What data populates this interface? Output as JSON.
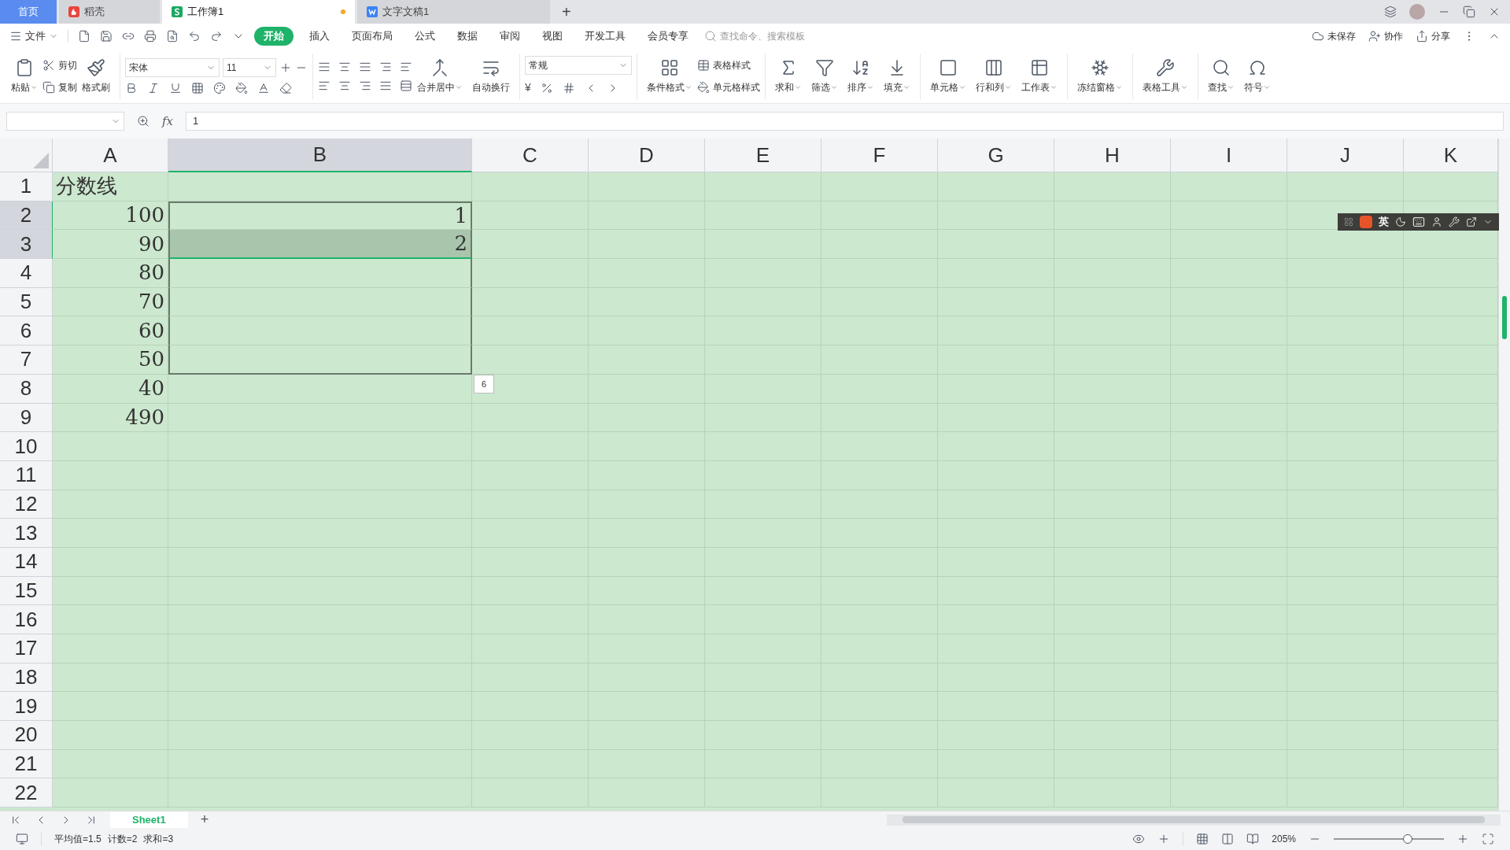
{
  "tabs": [
    {
      "label": "首页",
      "kind": "home",
      "selected": false,
      "unsaved": false
    },
    {
      "label": "稻壳",
      "kind": "docer",
      "selected": false,
      "unsaved": false
    },
    {
      "label": "工作簿1",
      "kind": "sheet",
      "selected": true,
      "unsaved": true
    },
    {
      "label": "文字文稿1",
      "kind": "doc",
      "selected": false,
      "unsaved": false
    }
  ],
  "new_tab": "+",
  "menu": {
    "file": "文件",
    "tabs": [
      {
        "label": "开始",
        "selected": true
      },
      {
        "label": "插入",
        "selected": false
      },
      {
        "label": "页面布局",
        "selected": false
      },
      {
        "label": "公式",
        "selected": false
      },
      {
        "label": "数据",
        "selected": false
      },
      {
        "label": "审阅",
        "selected": false
      },
      {
        "label": "视图",
        "selected": false
      },
      {
        "label": "开发工具",
        "selected": false
      },
      {
        "label": "会员专享",
        "selected": false
      }
    ],
    "search": {
      "placeholder": "查找命令、搜索模板"
    },
    "actions": [
      "未保存",
      "协作",
      "分享"
    ]
  },
  "ribbon": {
    "paste": "粘贴",
    "cut": "剪切",
    "copy": "复制",
    "format_painter": "格式刷",
    "font": "宋体",
    "size": "11",
    "merge": "合并居中",
    "wrap": "自动换行",
    "number_format": "常规",
    "currency": "¥",
    "conditional": "条件格式",
    "table_style": "表格样式",
    "cell_style": "单元格样式",
    "tools": [
      "求和",
      "筛选",
      "排序",
      "填充"
    ],
    "cells": [
      "单元格",
      "行和列",
      "工作表"
    ],
    "freeze": "冻结窗格",
    "table_tools": "表格工具",
    "find": [
      "查找",
      "符号"
    ]
  },
  "formula_bar": {
    "fx": "fx",
    "value": "1"
  },
  "columns": [
    {
      "label": "A",
      "selected": false
    },
    {
      "label": "B",
      "selected": true
    },
    {
      "label": "C",
      "selected": false
    },
    {
      "label": "D",
      "selected": false
    },
    {
      "label": "E",
      "selected": false
    },
    {
      "label": "F",
      "selected": false
    },
    {
      "label": "G",
      "selected": false
    },
    {
      "label": "H",
      "selected": false
    },
    {
      "label": "I",
      "selected": false
    },
    {
      "label": "J",
      "selected": false
    },
    {
      "label": "K",
      "selected": false
    }
  ],
  "rows": [
    {
      "number": "1",
      "selected": false,
      "in_selection": false,
      "active": false,
      "cells": [
        "分数线"
      ]
    },
    {
      "number": "2",
      "selected": true,
      "in_selection": true,
      "active": false,
      "cells": [
        "100",
        "1"
      ]
    },
    {
      "number": "3",
      "selected": true,
      "in_selection": true,
      "active": true,
      "cells": [
        "90",
        "2"
      ]
    },
    {
      "number": "4",
      "selected": false,
      "in_selection": true,
      "active": false,
      "cells": [
        "80"
      ]
    },
    {
      "number": "5",
      "selected": false,
      "in_selection": true,
      "active": false,
      "cells": [
        "70"
      ]
    },
    {
      "number": "6",
      "selected": false,
      "in_selection": true,
      "active": false,
      "cells": [
        "60"
      ]
    },
    {
      "number": "7",
      "selected": false,
      "in_selection": true,
      "active": false,
      "cells": [
        "50"
      ]
    },
    {
      "number": "8",
      "selected": false,
      "in_selection": false,
      "active": false,
      "cells": [
        "40"
      ]
    },
    {
      "number": "9",
      "selected": false,
      "in_selection": false,
      "active": false,
      "cells": [
        "490"
      ]
    },
    {
      "number": "10",
      "selected": false,
      "in_selection": false,
      "active": false,
      "cells": []
    },
    {
      "number": "11",
      "selected": false,
      "in_selection": false,
      "active": false,
      "cells": []
    },
    {
      "number": "12",
      "selected": false,
      "in_selection": false,
      "active": false,
      "cells": []
    },
    {
      "number": "13",
      "selected": false,
      "in_selection": false,
      "active": false,
      "cells": []
    },
    {
      "number": "14",
      "selected": false,
      "in_selection": false,
      "active": false,
      "cells": []
    },
    {
      "number": "15",
      "selected": false,
      "in_selection": false,
      "active": false,
      "cells": []
    },
    {
      "number": "16",
      "selected": false,
      "in_selection": false,
      "active": false,
      "cells": []
    },
    {
      "number": "17",
      "selected": false,
      "in_selection": false,
      "active": false,
      "cells": []
    },
    {
      "number": "18",
      "selected": false,
      "in_selection": false,
      "active": false,
      "cells": []
    },
    {
      "number": "19",
      "selected": false,
      "in_selection": false,
      "active": false,
      "cells": []
    },
    {
      "number": "20",
      "selected": false,
      "in_selection": false,
      "active": false,
      "cells": []
    },
    {
      "number": "21",
      "selected": false,
      "in_selection": false,
      "active": false,
      "cells": []
    },
    {
      "number": "22",
      "selected": false,
      "in_selection": false,
      "active": false,
      "cells": []
    }
  ],
  "fill_count": "6",
  "ime_toolbar": {
    "label": "英"
  },
  "sheet_tabs": [
    {
      "label": "Sheet1",
      "selected": true
    }
  ],
  "add_sheet": "+",
  "status": [
    "平均值=1.5",
    "计数=2",
    "求和=3"
  ],
  "zoom": {
    "reading": "205%",
    "level": 0.67
  }
}
